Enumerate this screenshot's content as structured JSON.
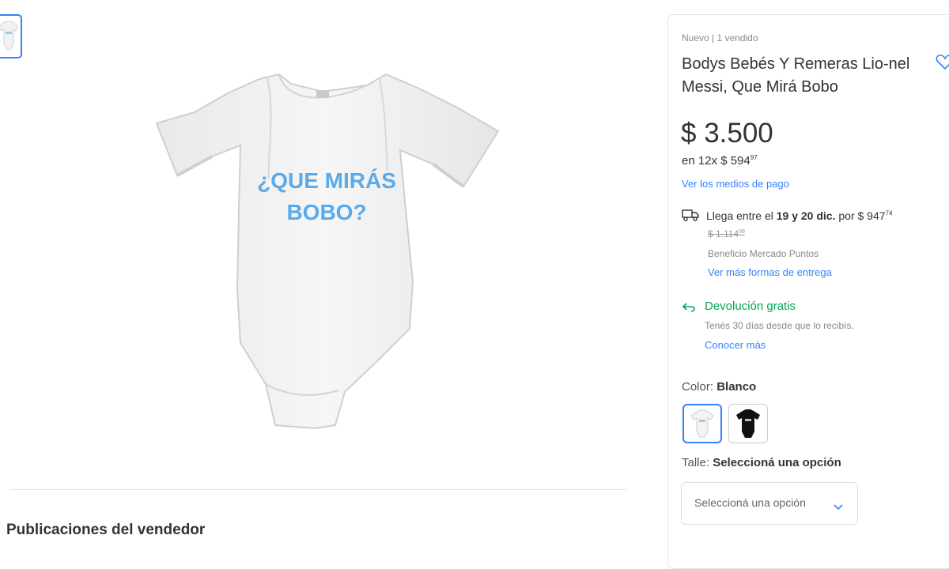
{
  "product": {
    "condition": "Nuevo  |  1 vendido",
    "title": "Bodys Bebés Y Remeras Lio-nel Messi, Que Mirá Bobo",
    "shirt_text_line1": "¿QUE MIRÁS",
    "shirt_text_line2": "BOBO?",
    "price": "$ 3.500",
    "installments_prefix": "en 12x $ 594",
    "installments_cents": "97",
    "payment_link": "Ver los medios de pago"
  },
  "shipping": {
    "text_prefix": "Llega entre el",
    "day1": "19",
    "connector": "y",
    "day2": "20 dic.",
    "price_prefix": "por $ 947",
    "price_cents": "74",
    "old_price": "$ 1.114",
    "old_cents": "99",
    "benefit": "Beneficio Mercado Puntos",
    "more_link": "Ver más formas de entrega"
  },
  "returns": {
    "label": "Devolución gratis",
    "subtext": "Tenés 30 días desde que lo recibís.",
    "link": "Conocer más"
  },
  "variants": {
    "color_label": "Color:",
    "color_value": "Blanco",
    "size_label": "Talle:",
    "size_value": "Seleccioná una opción",
    "size_placeholder": "Seleccioná una opción"
  },
  "below": {
    "related_title": "Publicaciones del vendedor"
  },
  "colors": {
    "accent": "#3483fa",
    "success": "#00a650",
    "print_blue": "#5aabea"
  },
  "icons": [
    "heart-icon",
    "truck-icon",
    "return-arrow-icon",
    "chevron-down-icon"
  ]
}
